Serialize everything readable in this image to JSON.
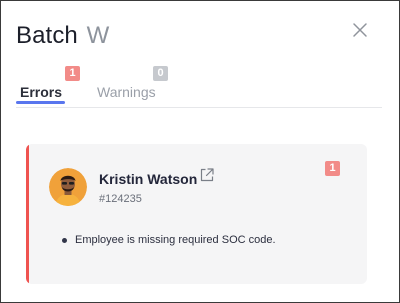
{
  "panel": {
    "title": "Batch",
    "title_suffix": "W"
  },
  "icons": {
    "close": "close-icon",
    "external_link": "external-link-icon",
    "avatar": "avatar"
  },
  "tabs": [
    {
      "label": "Errors",
      "count": "1",
      "active": true
    },
    {
      "label": "Warnings",
      "count": "0",
      "active": false
    }
  ],
  "errors": [
    {
      "employee_name": "Kristin Watson",
      "employee_id": "#124235",
      "count": "1",
      "messages": [
        "Employee is missing required SOC code."
      ]
    }
  ],
  "colors": {
    "accent_blue": "#5976ee",
    "error_red": "#ef5350",
    "error_badge": "#f28b88",
    "warning_badge": "#c6c9ce",
    "card_background": "#f5f5f6"
  }
}
